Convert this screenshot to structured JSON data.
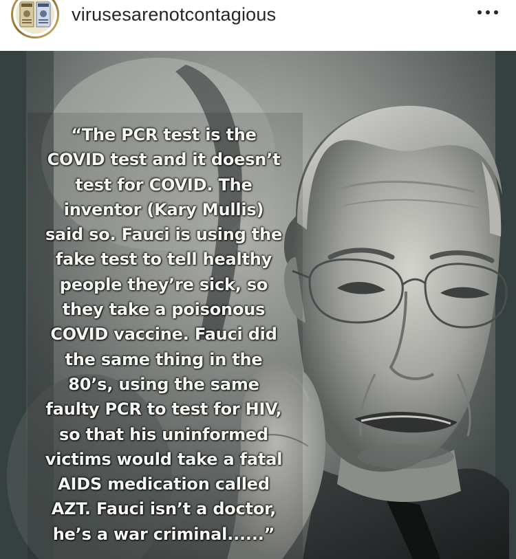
{
  "post": {
    "username": "virusesarenotcontagious",
    "more_icon": "more-horizontal-icon",
    "avatar_icon": "profile-avatar-icon"
  },
  "image": {
    "quote_lines": [
      "“The PCR test is the",
      "COVID test and it doesn’t",
      "test for COVID. The",
      "inventor (Kary Mullis)",
      "said so. Fauci is using the",
      "fake test to tell healthy",
      "people they’re sick, so",
      "they take a poisonous",
      "COVID vaccine. Fauci did",
      "the same thing in the",
      "80’s, using the same",
      "faulty PCR to test for HIV,",
      "so that his uninformed",
      "victims would take a fatal",
      "AIDS medication called",
      "AZT. Fauci isn’t a doctor,",
      "he’s a war criminal......”"
    ]
  },
  "colors": {
    "text": "#f5f6f1",
    "username": "#262626",
    "frame": "#3a4342"
  }
}
